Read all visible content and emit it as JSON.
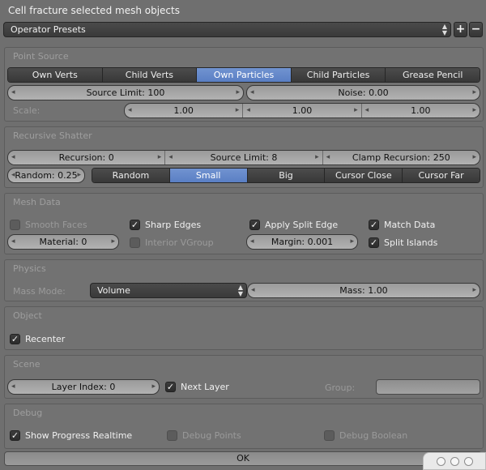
{
  "title": "Cell fracture selected mesh objects",
  "presets": {
    "label": "Operator Presets",
    "add": "+",
    "remove": "−"
  },
  "point_source": {
    "title": "Point Source",
    "options": [
      "Own Verts",
      "Child Verts",
      "Own Particles",
      "Child Particles",
      "Grease Pencil"
    ],
    "active_index": 2,
    "source_limit": "Source Limit: 100",
    "noise": "Noise: 0.00",
    "scale_label": "Scale:",
    "scale": [
      "1.00",
      "1.00",
      "1.00"
    ]
  },
  "recursive_shatter": {
    "title": "Recursive Shatter",
    "recursion": "Recursion: 0",
    "source_limit": "Source Limit: 8",
    "clamp_recursion": "Clamp Recursion: 250",
    "random": "Random: 0.25",
    "options": [
      "Random",
      "Small",
      "Big",
      "Cursor Close",
      "Cursor Far"
    ],
    "active_index": 1
  },
  "mesh_data": {
    "title": "Mesh Data",
    "smooth_faces": "Smooth Faces",
    "sharp_edges": "Sharp Edges",
    "apply_split_edge": "Apply Split Edge",
    "match_data": "Match Data",
    "material": "Material: 0",
    "interior_vgroup": "Interior VGroup",
    "margin": "Margin: 0.001",
    "split_islands": "Split Islands"
  },
  "physics": {
    "title": "Physics",
    "mass_mode_label": "Mass Mode:",
    "mass_mode_value": "Volume",
    "mass": "Mass: 1.00"
  },
  "object": {
    "title": "Object",
    "recenter": "Recenter"
  },
  "scene": {
    "title": "Scene",
    "layer_index": "Layer Index: 0",
    "next_layer": "Next Layer",
    "group_label": "Group:"
  },
  "debug": {
    "title": "Debug",
    "show_progress": "Show Progress Realtime",
    "debug_points": "Debug Points",
    "debug_boolean": "Debug Boolean"
  },
  "ok_label": "OK"
}
